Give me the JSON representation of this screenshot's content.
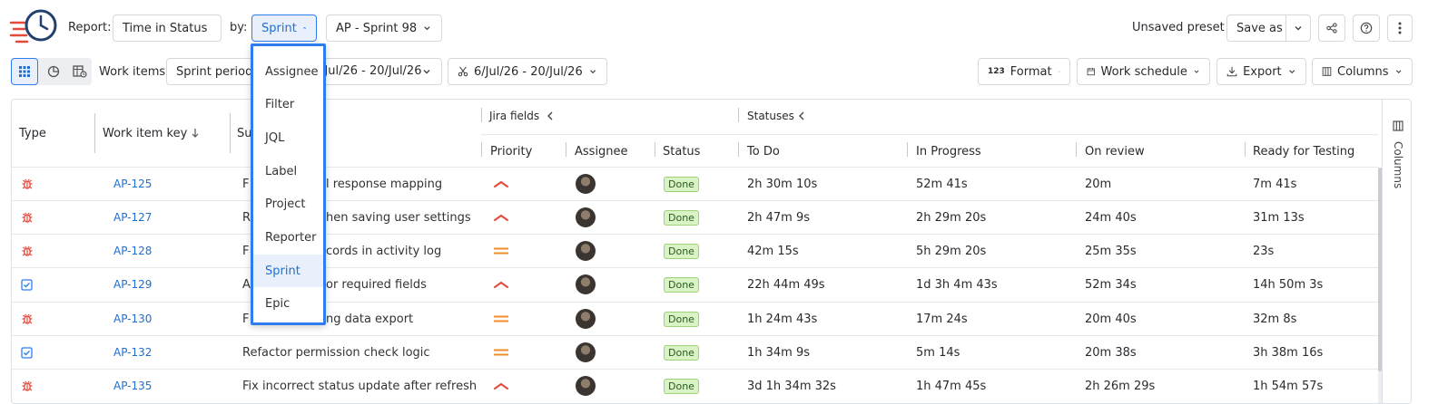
{
  "toolbar": {
    "report_label": "Report:",
    "report_value": "Time in Status",
    "by_label": "by:",
    "by_value": "Sprint",
    "sprint_value": "AP - Sprint 98",
    "unsaved": "Unsaved preset",
    "save_as": "Save as"
  },
  "filters": {
    "work_items_label": "Work items:",
    "period_value": "Sprint period",
    "date_range_1": "/Jul/26 - 20/Jul/26",
    "date_range_2": "6/Jul/26 - 20/Jul/26",
    "format": "Format",
    "format_glyph": "123",
    "work_schedule": "Work schedule",
    "export": "Export",
    "columns": "Columns"
  },
  "dropdown": {
    "items": [
      "Assignee",
      "Filter",
      "JQL",
      "Label",
      "Project",
      "Reporter",
      "Sprint",
      "Epic"
    ],
    "selected": "Sprint"
  },
  "table": {
    "groups": {
      "jira_fields": "Jira fields",
      "statuses": "Statuses"
    },
    "headers": {
      "type": "Type",
      "key": "Work item key",
      "summary": "Su",
      "priority": "Priority",
      "assignee": "Assignee",
      "status": "Status",
      "todo": "To Do",
      "inprogress": "In Progress",
      "onreview": "On review",
      "ready": "Ready for Testing"
    },
    "rows": [
      {
        "type": "bug",
        "key": "AP-125",
        "summary_a": "F",
        "summary_b": "l response mapping",
        "priority": "high",
        "status": "Done",
        "todo": "2h 30m 10s",
        "inprogress": "52m 41s",
        "onreview": "20m",
        "ready": "7m 41s"
      },
      {
        "type": "bug",
        "key": "AP-127",
        "summary_a": "R",
        "summary_b": "hen saving user settings",
        "priority": "high",
        "status": "Done",
        "todo": "2h 47m 9s",
        "inprogress": "2h 29m 20s",
        "onreview": "24m 40s",
        "ready": "31m 13s"
      },
      {
        "type": "bug",
        "key": "AP-128",
        "summary_a": "F",
        "summary_b": "cords in activity log",
        "priority": "medium",
        "status": "Done",
        "todo": "42m 15s",
        "inprogress": "5h 29m 20s",
        "onreview": "25m 35s",
        "ready": "23s"
      },
      {
        "type": "task",
        "key": "AP-129",
        "summary_a": "A",
        "summary_b": "or required fields",
        "priority": "high",
        "status": "Done",
        "todo": "22h 44m 49s",
        "inprogress": "1d 3h 4m 43s",
        "onreview": "52m 34s",
        "ready": "14h 50m 3s"
      },
      {
        "type": "bug",
        "key": "AP-130",
        "summary_a": "F",
        "summary_b": "ng data export",
        "priority": "medium",
        "status": "Done",
        "todo": "1h 24m 43s",
        "inprogress": "17m 24s",
        "onreview": "20m 40s",
        "ready": "32m 8s"
      },
      {
        "type": "task",
        "key": "AP-132",
        "summary_a": "Refactor permission check logic",
        "summary_b": "",
        "priority": "medium",
        "status": "Done",
        "todo": "1h 34m 9s",
        "inprogress": "5m 14s",
        "onreview": "20m 38s",
        "ready": "3h 38m 16s"
      },
      {
        "type": "bug",
        "key": "AP-135",
        "summary_a": "Fix incorrect status update after refresh",
        "summary_b": "",
        "priority": "high",
        "status": "Done",
        "todo": "3d 1h 34m 32s",
        "inprogress": "1h 47m 45s",
        "onreview": "2h 26m 29s",
        "ready": "1h 54m 57s"
      }
    ]
  },
  "side_panel": {
    "label": "Columns"
  },
  "colors": {
    "accent": "#1f6fd1",
    "bug": "#e5493a",
    "task": "#2f7cf0",
    "priority_high": "#e5493a",
    "priority_medium": "#f08c2a",
    "done_bg": "#d8f3c4"
  }
}
